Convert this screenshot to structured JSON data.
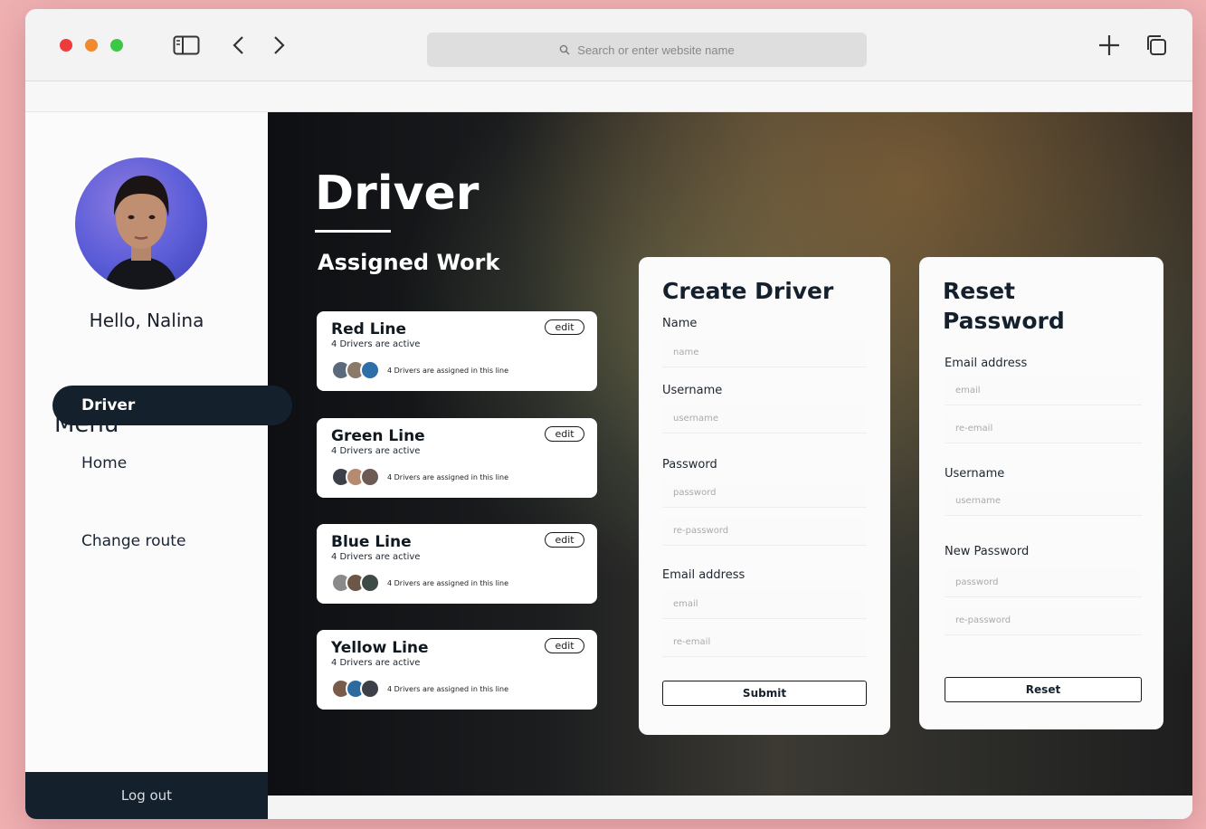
{
  "browser": {
    "address_placeholder": "Search or enter website name"
  },
  "sidebar": {
    "greeting": "Hello, Nalina",
    "menu_title": "Menu",
    "items": [
      {
        "label": "Home"
      },
      {
        "label": "Driver"
      },
      {
        "label": "Change route"
      }
    ],
    "active_item": "Driver",
    "logout_label": "Log out"
  },
  "main": {
    "title": "Driver",
    "section_title": "Assigned Work",
    "lines": [
      {
        "name": "Red Line",
        "active": "4 Drivers are active",
        "assigned": "4 Drivers are assigned in this line",
        "edit": "edit"
      },
      {
        "name": "Green Line",
        "active": "4 Drivers are active",
        "assigned": "4 Drivers are assigned in this line",
        "edit": "edit"
      },
      {
        "name": "Blue Line",
        "active": "4 Drivers are active",
        "assigned": "4 Drivers are assigned in this line",
        "edit": "edit"
      },
      {
        "name": "Yellow Line",
        "active": "4 Drivers are active",
        "assigned": "4 Drivers are assigned in this line",
        "edit": "edit"
      }
    ]
  },
  "create_driver": {
    "title": "Create Driver",
    "name_label": "Name",
    "name_placeholder": "name",
    "username_label": "Username",
    "username_placeholder": "username",
    "password_label": "Password",
    "password_placeholder": "password",
    "repassword_placeholder": "re-password",
    "email_label": "Email address",
    "email_placeholder": "email",
    "reemail_placeholder": "re-email",
    "submit_label": "Submit"
  },
  "reset_password": {
    "title_line1": "Reset",
    "title_line2": "Password",
    "email_label": "Email address",
    "email_placeholder": "email",
    "reemail_placeholder": "re-email",
    "username_label": "Username",
    "username_placeholder": "username",
    "newpassword_label": "New Password",
    "password_placeholder": "password",
    "repassword_placeholder": "re-password",
    "reset_label": "Reset"
  },
  "colors": {
    "sidebar_dark": "#15202d",
    "background_pink": "#f0b1b3"
  }
}
